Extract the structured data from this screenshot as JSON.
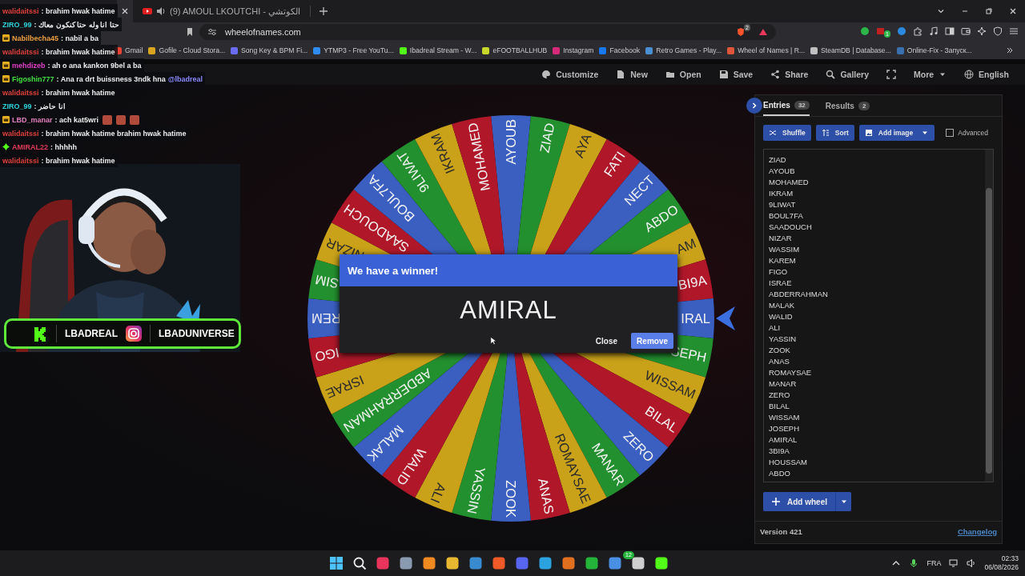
{
  "browser": {
    "tabs": [
      {
        "selected": true
      },
      {
        "title": "(9) AMOUL LKOUTCHI - الكوتشي",
        "selected": false
      }
    ],
    "url": "wheelofnames.com",
    "shield_badge": "2",
    "extension_badge": "1",
    "bookmarks": [
      {
        "label": "Gmail",
        "color": "#ea4335"
      },
      {
        "label": "Gofile - Cloud Stora...",
        "color": "#d9a520"
      },
      {
        "label": "Song Key & BPM Fi...",
        "color": "#6b6bf0"
      },
      {
        "label": "YTMP3 - Free YouTu...",
        "color": "#2f8cf0"
      },
      {
        "label": "Ibadreal Stream - W...",
        "color": "#53fc18"
      },
      {
        "label": "eFOOTBALLHUB",
        "color": "#c8d82a"
      },
      {
        "label": "Instagram",
        "color": "#d6297a"
      },
      {
        "label": "Facebook",
        "color": "#1877f2"
      },
      {
        "label": "Retro Games - Play...",
        "color": "#4a8fd0"
      },
      {
        "label": "Wheel of Names | R...",
        "color": "#e0563a"
      },
      {
        "label": "SteamDB | Database...",
        "color": "#c0c0c0"
      },
      {
        "label": "Online-Fix - Запуск...",
        "color": "#3a6fb0"
      }
    ]
  },
  "chat": [
    {
      "user": "walidaitssi",
      "color": "#e0413a",
      "kind": "none",
      "message": ": brahim hwak hatime"
    },
    {
      "user": "ZIRO_99",
      "color": "#2fd0d8",
      "kind": "none",
      "message": ": حتا انا وله حتا كنكون معاك"
    },
    {
      "user": "Nabilbecha45",
      "color": "#f0a040",
      "kind": "crown",
      "message": ": nabil a ba"
    },
    {
      "user": "walidaitssi",
      "color": "#e0413a",
      "kind": "none",
      "message": ": brahim hwak hatime"
    },
    {
      "user": "mehdizeb",
      "color": "#e040c8",
      "kind": "crown",
      "message": ": ah o ana kankon 9bel a ba"
    },
    {
      "user": "Figoshin777",
      "color": "#40e040",
      "kind": "crown",
      "message": ": Ana ra drt buissness 3ndk hna",
      "mention": "@lbadreal"
    },
    {
      "user": "walidaitssi",
      "color": "#e0413a",
      "kind": "none",
      "message": ": brahim hwak hatime"
    },
    {
      "user": "ZIRO_99",
      "color": "#2fd0d8",
      "kind": "none",
      "message": ": انا حاضر"
    },
    {
      "user": "LBD_manar",
      "color": "#e080c0",
      "kind": "crown",
      "message": ": ach kat5wri"
    },
    {
      "user": "walidaitssi",
      "color": "#e0413a",
      "kind": "none",
      "message": ": brahim hwak hatime brahim hwak hatime"
    },
    {
      "user": "AMIRAL22",
      "color": "#e03a5a",
      "kind": "gem",
      "message": ": hhhhh"
    },
    {
      "user": "walidaitssi",
      "color": "#e0413a",
      "kind": "none",
      "message": ": brahim hwak hatime"
    }
  ],
  "stream": {
    "socials": [
      "LBADREAL",
      "LBADUNIVERSE"
    ]
  },
  "site": {
    "menu": [
      "Customize",
      "New",
      "Open",
      "Save",
      "Share",
      "Gallery"
    ],
    "more": "More",
    "language": "English"
  },
  "wheel": {
    "segments": [
      {
        "label": "AYOUB"
      },
      {
        "label": "ZIAD"
      },
      {
        "label": "AYA"
      },
      {
        "label": "FATI"
      },
      {
        "label": "NECT"
      },
      {
        "label": "ABDO"
      },
      {
        "label": "AM"
      },
      {
        "label": "BI9A"
      },
      {
        "label": "IRAL"
      },
      {
        "label": "SEPH"
      },
      {
        "label": "WISSAM"
      },
      {
        "label": "BILAL"
      },
      {
        "label": "ZERO"
      },
      {
        "label": "MANAR"
      },
      {
        "label": "ROMAYSAE"
      },
      {
        "label": "ANAS"
      },
      {
        "label": "ZOOK"
      },
      {
        "label": "YASSIN"
      },
      {
        "label": "ALI"
      },
      {
        "label": "WALID"
      },
      {
        "label": "MALAK"
      },
      {
        "label": "ABDERRAHMAN"
      },
      {
        "label": "ISRAE"
      },
      {
        "label": "IGO"
      },
      {
        "label": "REM"
      },
      {
        "label": "SIM"
      },
      {
        "label": "NIZAR"
      },
      {
        "label": "SAADOUCH"
      },
      {
        "label": "BOUL7FA"
      },
      {
        "label": "9LIWAT"
      },
      {
        "label": "IKRAM"
      },
      {
        "label": "MOHAMED"
      }
    ],
    "winner_dialog": {
      "title": "We have a winner!",
      "winner": "AMIRAL",
      "buttons": [
        "Close",
        "Remove"
      ]
    }
  },
  "panel": {
    "tabs": [
      {
        "label": "Entries",
        "count": "32",
        "selected": true
      },
      {
        "label": "Results",
        "count": "2",
        "selected": false
      }
    ],
    "tools": [
      "Shuffle",
      "Sort",
      "Add image"
    ],
    "advanced": {
      "label": "Advanced",
      "checked": false
    },
    "entries": [
      "ZIAD",
      "AYOUB",
      "MOHAMED",
      "IKRAM",
      "9LIWAT",
      "BOUL7FA",
      "SAADOUCH",
      "NIZAR",
      "WASSIM",
      "KAREM",
      "FIGO",
      "ISRAE",
      "ABDERRAHMAN",
      "MALAK",
      "WALID",
      "ALI",
      "YASSIN",
      "ZOOK",
      "ANAS",
      "ROMAYSAE",
      "MANAR",
      "ZERO",
      "BILAL",
      "WISSAM",
      "JOSEPH",
      "AMIRAL",
      "3BI9A",
      "HOUSSAM",
      "ABDO"
    ],
    "add_wheel": "Add wheel",
    "version": "Version 421",
    "changelog": "Changelog"
  },
  "taskbar": {
    "message_badge": "12",
    "language": "FRA",
    "time": "02:33",
    "date": "06/08/2026"
  }
}
